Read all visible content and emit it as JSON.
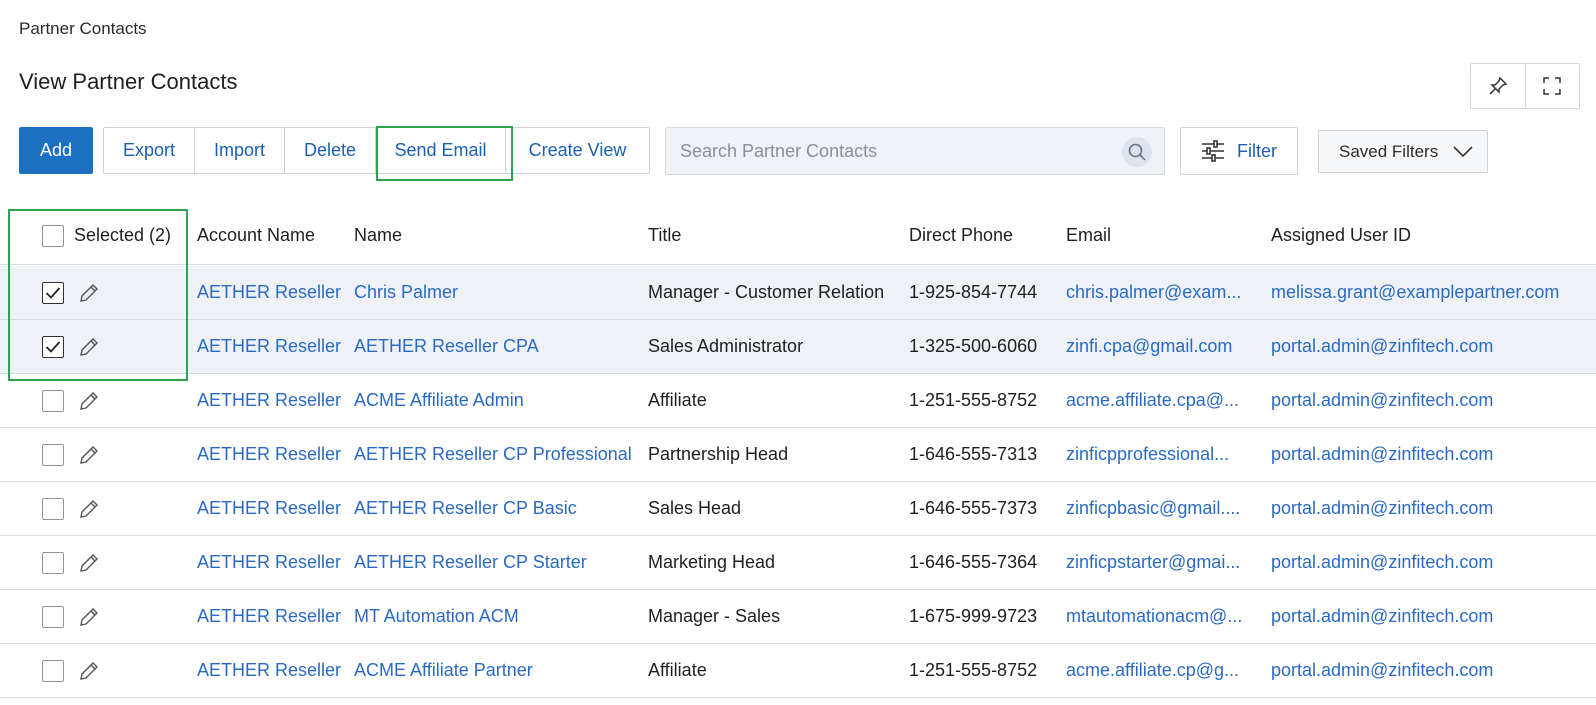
{
  "breadcrumb": "Partner Contacts",
  "page_title": "View Partner Contacts",
  "window_actions": {
    "pin_icon": "pin-icon",
    "fullscreen_icon": "fullscreen-icon"
  },
  "toolbar": {
    "add_label": "Add",
    "export_label": "Export",
    "import_label": "Import",
    "delete_label": "Delete",
    "send_email_label": "Send Email",
    "create_view_label": "Create View"
  },
  "search": {
    "placeholder": "Search Partner Contacts",
    "icon": "search-icon"
  },
  "filter": {
    "label": "Filter",
    "icon": "sliders-icon"
  },
  "saved_filters": {
    "label": "Saved Filters",
    "icon": "chevron-down-icon"
  },
  "table": {
    "headers": {
      "selected": "Selected (2)",
      "account_name": "Account Name",
      "name": "Name",
      "title": "Title",
      "direct_phone": "Direct Phone",
      "email": "Email",
      "assigned_user": "Assigned User ID"
    },
    "rows": [
      {
        "checked": true,
        "account": "AETHER Reseller",
        "name": "Chris Palmer",
        "title": "Manager - Customer Relation",
        "phone": "1-925-854-7744",
        "email": "chris.palmer@exam...",
        "assigned": "melissa.grant@examplepartner.com"
      },
      {
        "checked": true,
        "account": "AETHER Reseller",
        "name": "AETHER Reseller CPA",
        "title": "Sales Administrator",
        "phone": "1-325-500-6060",
        "email": "zinfi.cpa@gmail.com",
        "assigned": "portal.admin@zinfitech.com"
      },
      {
        "checked": false,
        "account": "AETHER Reseller",
        "name": "ACME Affiliate Admin",
        "title": "Affiliate",
        "phone": "1-251-555-8752",
        "email": "acme.affiliate.cpa@...",
        "assigned": "portal.admin@zinfitech.com"
      },
      {
        "checked": false,
        "account": "AETHER Reseller",
        "name": "AETHER Reseller CP Professional",
        "title": "Partnership Head",
        "phone": "1-646-555-7313",
        "email": "zinficpprofessional...",
        "assigned": "portal.admin@zinfitech.com"
      },
      {
        "checked": false,
        "account": "AETHER Reseller",
        "name": "AETHER Reseller CP Basic",
        "title": "Sales Head",
        "phone": "1-646-555-7373",
        "email": "zinficpbasic@gmail....",
        "assigned": "portal.admin@zinfitech.com"
      },
      {
        "checked": false,
        "account": "AETHER Reseller",
        "name": "AETHER Reseller CP Starter",
        "title": "Marketing Head",
        "phone": "1-646-555-7364",
        "email": "zinficpstarter@gmai...",
        "assigned": "portal.admin@zinfitech.com"
      },
      {
        "checked": false,
        "account": "AETHER Reseller",
        "name": "MT Automation ACM",
        "title": "Manager - Sales",
        "phone": "1-675-999-9723",
        "email": "mtautomationacm@...",
        "assigned": "portal.admin@zinfitech.com"
      },
      {
        "checked": false,
        "account": "AETHER Reseller",
        "name": "ACME Affiliate Partner",
        "title": "Affiliate",
        "phone": "1-251-555-8752",
        "email": "acme.affiliate.cp@g...",
        "assigned": "portal.admin@zinfitech.com"
      }
    ]
  },
  "colors": {
    "primary": "#1c6fc1",
    "link": "#2b6ac4",
    "highlight": "#2ea44f",
    "selected_row": "#eef2f7"
  }
}
